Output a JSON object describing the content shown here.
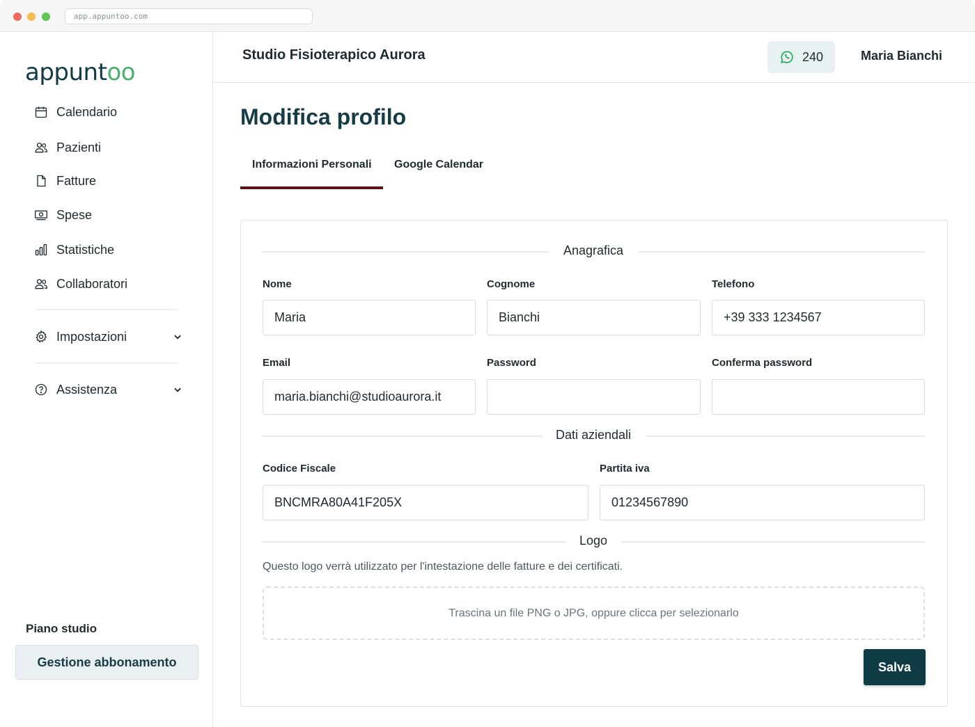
{
  "browser": {
    "url": "app.appuntoo.com"
  },
  "brand": {
    "logo_main": "appunt",
    "logo_accent": "oo"
  },
  "sidebar": {
    "items": [
      {
        "label": "Calendario",
        "icon": "calendar-icon"
      },
      {
        "label": "Pazienti",
        "icon": "users-icon"
      },
      {
        "label": "Fatture",
        "icon": "document-icon"
      },
      {
        "label": "Spese",
        "icon": "money-icon"
      },
      {
        "label": "Statistiche",
        "icon": "bar-chart-icon"
      },
      {
        "label": "Collaboratori",
        "icon": "users-icon"
      }
    ],
    "settings_label": "Impostazioni",
    "help_label": "Assistenza",
    "plan_label": "Piano studio",
    "plan_button": "Gestione abbonamento"
  },
  "header": {
    "studio_name": "Studio Fisioterapico Aurora",
    "whatsapp_count": "240",
    "user_name": "Maria Bianchi"
  },
  "main": {
    "title": "Modifica profilo",
    "tabs": [
      {
        "label": "Informazioni Personali",
        "active": true
      },
      {
        "label": "Google Calendar",
        "active": false
      }
    ],
    "sections": {
      "anagrafica": "Anagrafica",
      "dati_aziendali": "Dati aziendali",
      "logo": "Logo"
    },
    "fields": {
      "nome": {
        "label": "Nome",
        "value": "Maria"
      },
      "cognome": {
        "label": "Cognome",
        "value": "Bianchi"
      },
      "telefono": {
        "label": "Telefono",
        "value": "+39 333 1234567"
      },
      "email": {
        "label": "Email",
        "value": "maria.bianchi@studioaurora.it"
      },
      "password": {
        "label": "Password",
        "value": ""
      },
      "conferma": {
        "label": "Conferma password",
        "value": ""
      },
      "codice_fiscale": {
        "label": "Codice Fiscale",
        "value": "BNCMRA80A41F205X"
      },
      "partita_iva": {
        "label": "Partita iva",
        "value": "01234567890"
      }
    },
    "logo_help": "Questo logo verrà utilizzato per l'intestazione delle fatture e dei certificati.",
    "dropzone_text": "Trascina un file PNG o JPG, oppure clicca per selezionarlo",
    "save_label": "Salva"
  },
  "colors": {
    "brand_dark": "#0f3b44",
    "brand_green": "#49b06d",
    "tab_underline": "#5a1212",
    "whatsapp_green": "#25a85a"
  }
}
